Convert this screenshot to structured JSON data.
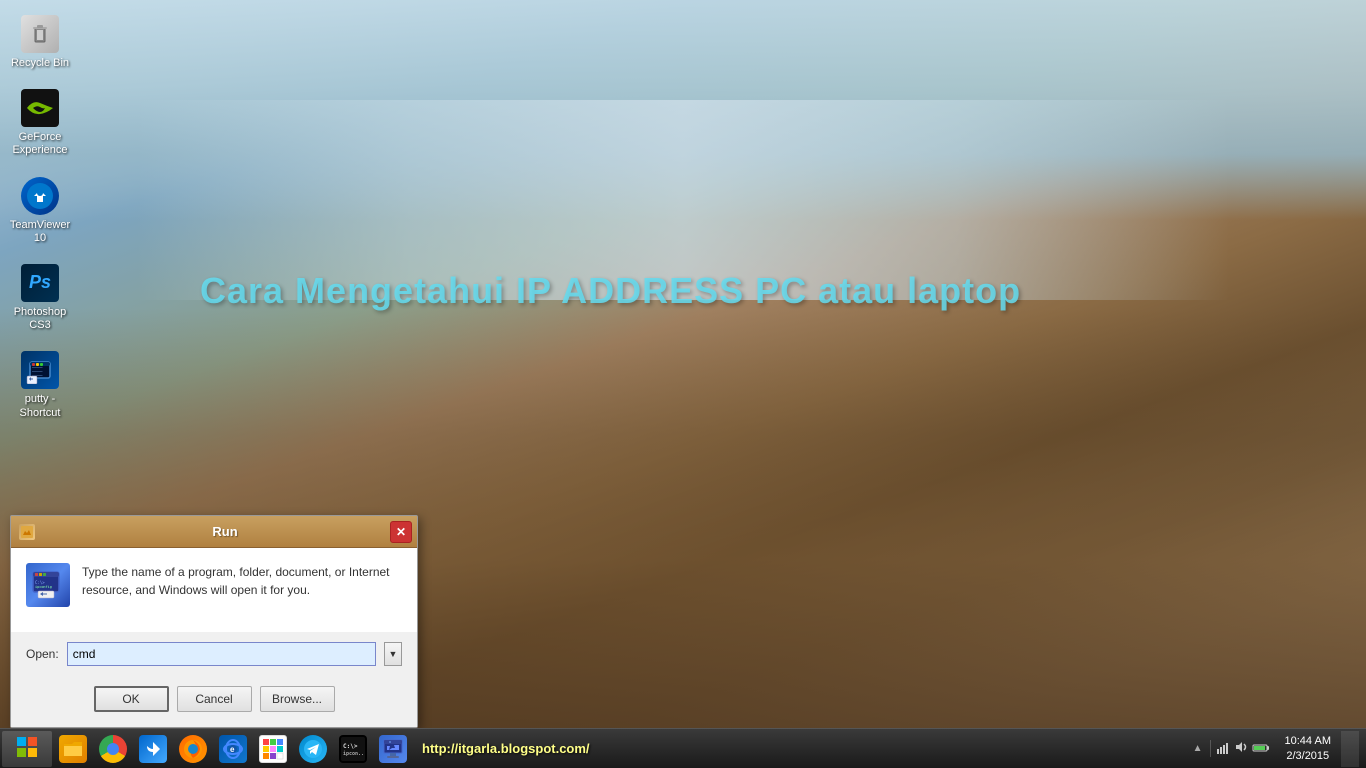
{
  "desktop": {
    "background_desc": "rocky landscape with misty water and blue sky",
    "watermark": "Cara Mengetahui IP ADDRESS PC atau laptop"
  },
  "desktop_icons": [
    {
      "id": "recycle-bin",
      "label": "Recycle Bin",
      "icon_type": "recycle"
    },
    {
      "id": "geforce-experience",
      "label": "GeForce Experience",
      "icon_type": "geforce"
    },
    {
      "id": "teamviewer",
      "label": "TeamViewer 10",
      "icon_type": "teamviewer"
    },
    {
      "id": "photoshop-cs3",
      "label": "Photoshop CS3",
      "icon_type": "photoshop"
    },
    {
      "id": "putty-shortcut",
      "label": "putty - Shortcut",
      "icon_type": "putty"
    }
  ],
  "run_dialog": {
    "title": "Run",
    "message": "Type the name of a program, folder, document, or Internet resource, and Windows will open it for you.",
    "open_label": "Open:",
    "open_value": "cmd",
    "ok_label": "OK",
    "cancel_label": "Cancel",
    "browse_label": "Browse..."
  },
  "taskbar": {
    "url": "http://itgarla.blogspot.com/",
    "clock": "10:44 AM",
    "date": "2/3/2015",
    "icons": [
      {
        "id": "files",
        "type": "files",
        "label": "File Explorer"
      },
      {
        "id": "chrome",
        "type": "chrome",
        "label": "Google Chrome"
      },
      {
        "id": "arrow",
        "type": "arrow",
        "label": "App Store"
      },
      {
        "id": "firefox",
        "type": "firefox",
        "label": "Firefox"
      },
      {
        "id": "ie",
        "type": "ie",
        "label": "Internet Explorer"
      },
      {
        "id": "paint",
        "type": "paint",
        "label": "Paint"
      },
      {
        "id": "telegram",
        "type": "telegram",
        "label": "Telegram"
      },
      {
        "id": "cmd",
        "type": "cmd",
        "label": "Command Prompt"
      },
      {
        "id": "pc",
        "type": "pc",
        "label": "Remote Desktop"
      }
    ]
  }
}
